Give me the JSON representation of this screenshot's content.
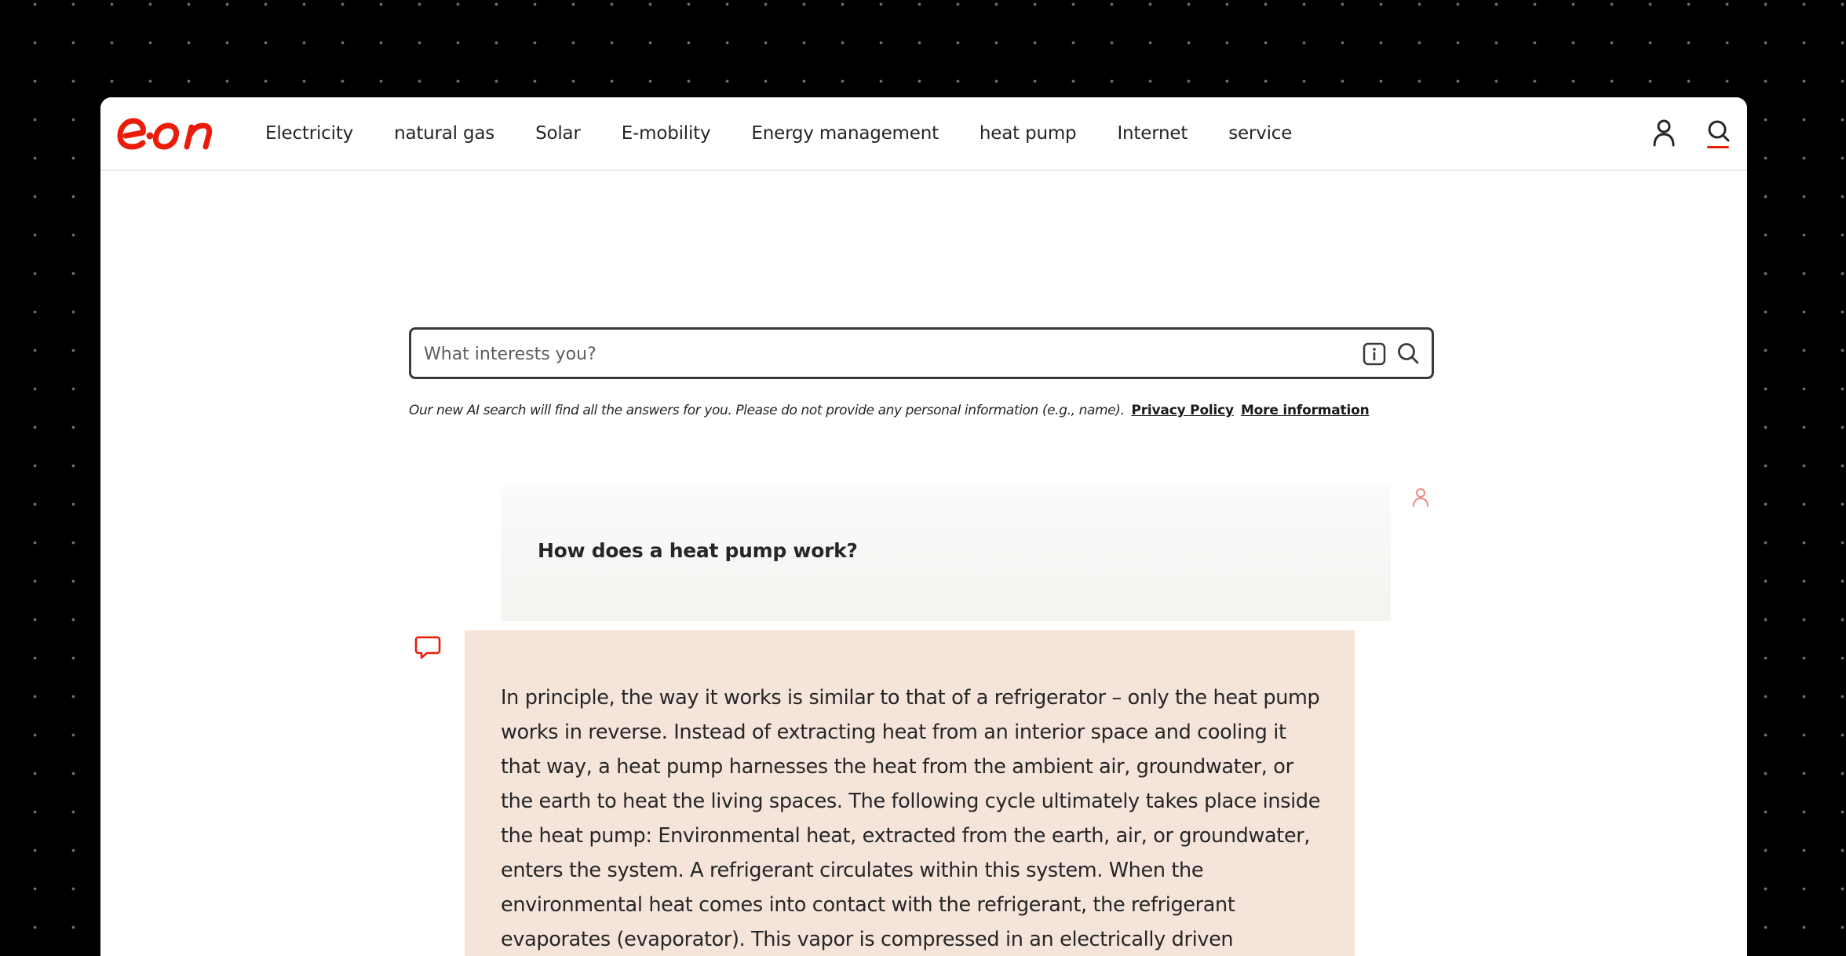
{
  "brand": {
    "logo_text": "e·on",
    "accent_color": "#ea1c0a"
  },
  "nav": {
    "items": [
      {
        "label": "Electricity"
      },
      {
        "label": "natural gas"
      },
      {
        "label": "Solar"
      },
      {
        "label": "E-mobility"
      },
      {
        "label": "Energy management"
      },
      {
        "label": "heat pump"
      },
      {
        "label": "Internet"
      },
      {
        "label": "service"
      }
    ],
    "icons": [
      "user-icon",
      "search-icon"
    ]
  },
  "search": {
    "placeholder": "What interests you?",
    "value": "",
    "icons": [
      "info-icon",
      "search-icon"
    ]
  },
  "disclaimer": {
    "text": "Our new AI search will find all the answers for you. Please do not provide any personal information (e.g., name).",
    "privacy_label": "Privacy Policy",
    "more_label": "More information"
  },
  "chat": {
    "question": "How does a heat pump work?",
    "answer": "In principle, the way it works is similar to that of a refrigerator – only the heat pump works in reverse. Instead of extracting heat from an interior space and cooling it that way, a heat pump harnesses the heat from the ambient air, groundwater, or the earth to heat the living spaces. The following cycle ultimately takes place inside the heat pump: Environmental heat, extracted from the earth, air, or groundwater, enters the system. A refrigerant circulates within this system. When the environmental heat comes into contact with the refrigerant, the refrigerant evaporates (evaporator). This vapor is compressed in an electrically driven compressor, further increasing its temperature. A",
    "question_bg": "#f4f3f0",
    "answer_bg": "#f4e4da",
    "avatars": [
      "user-icon",
      "chat-bubble-icon"
    ]
  }
}
